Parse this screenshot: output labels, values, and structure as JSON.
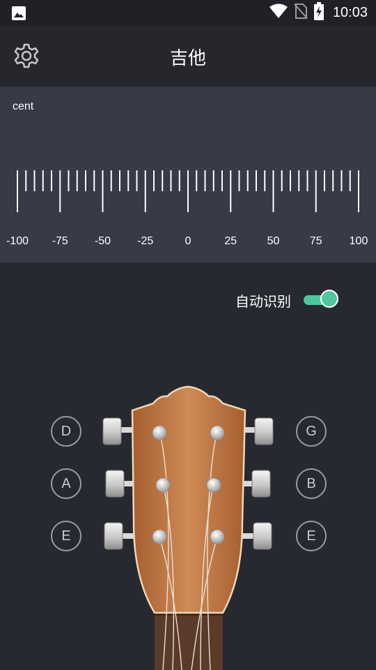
{
  "status_bar": {
    "time": "10:03",
    "icons": [
      "image-icon",
      "wifi-icon",
      "no-sim-icon",
      "battery-charging-icon"
    ]
  },
  "app_bar": {
    "title": "吉他",
    "settings_icon": "gear-icon"
  },
  "cent_meter": {
    "label": "cent",
    "scale_labels": [
      "-100",
      "-75",
      "-50",
      "-25",
      "0",
      "25",
      "50",
      "75",
      "100"
    ]
  },
  "auto_detect": {
    "label": "自动识别",
    "enabled": true,
    "accent": "#4fc79e"
  },
  "strings": {
    "left": [
      "D",
      "A",
      "E"
    ],
    "right": [
      "G",
      "B",
      "E"
    ]
  },
  "colors": {
    "background": "#272930",
    "panel": "#373a47",
    "headstock": "#c17a45",
    "fretboard": "#5a3a28"
  }
}
